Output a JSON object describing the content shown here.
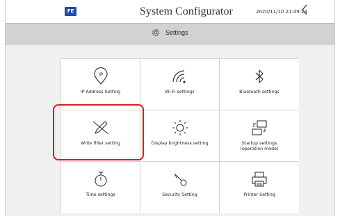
{
  "header": {
    "logo_text": "FE",
    "title": "System Configurator",
    "datetime": "2020/11/10 21:49:24",
    "back_icon": "chevron-left-icon"
  },
  "subbar": {
    "title": "Settings",
    "icon": "gear-icon"
  },
  "tiles": [
    {
      "label": "IP Address Setting",
      "icon": "ip-icon"
    },
    {
      "label": "Wi-Fi settings",
      "icon": "wifi-icon"
    },
    {
      "label": "Bluetooth settings",
      "icon": "bluetooth-icon"
    },
    {
      "label": "Write filter setting",
      "icon": "pen-cross-icon"
    },
    {
      "label": "Display brightness setting",
      "icon": "brightness-icon"
    },
    {
      "label": "Startup settings\n(operation mode)",
      "icon": "startup-icon"
    },
    {
      "label": "Time settings",
      "icon": "stopwatch-icon"
    },
    {
      "label": "Security Setting",
      "icon": "key-icon"
    },
    {
      "label": "Printer Setting",
      "icon": "printer-icon"
    }
  ],
  "colors": {
    "brand": "#1f4fa8",
    "highlight": "#e0191f",
    "icon_stroke": "#333333"
  }
}
